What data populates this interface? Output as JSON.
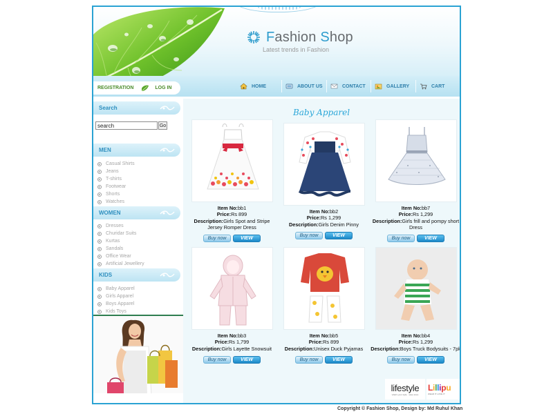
{
  "header": {
    "title_first_letter": "F",
    "title_part1": "ashion ",
    "title_second_letter": "S",
    "title_part2": "hop",
    "tagline": "Latest trends in Fashion"
  },
  "auth": {
    "register_label": "REGISTRATION",
    "login_label": "LOG IN"
  },
  "nav": {
    "items": [
      {
        "label": "HOME",
        "icon": "home-icon"
      },
      {
        "label": "ABOUT US",
        "icon": "about-icon"
      },
      {
        "label": "CONTACT",
        "icon": "mail-icon"
      },
      {
        "label": "GALLERY",
        "icon": "gallery-icon"
      },
      {
        "label": "CART",
        "icon": "cart-icon"
      }
    ]
  },
  "sidebar": {
    "search_heading": "Search",
    "search_value": "search",
    "go_label": "Go",
    "sections": [
      {
        "heading": "MEN",
        "items": [
          "Casual Shirts",
          "Jeans",
          "T-shirts",
          "Footwear",
          "Shorts",
          "Watches"
        ]
      },
      {
        "heading": "WOMEN",
        "items": [
          "Dresses",
          "Churidar Suits",
          "Kurtas",
          "Sandals",
          "Office Wear",
          "Artificial Jewellery"
        ]
      },
      {
        "heading": "KIDS",
        "items": [
          "Baby Apparel",
          "Girls Apparel",
          "Boys Apparel",
          "Kids Toys"
        ]
      }
    ]
  },
  "main": {
    "section_title": "Baby Apparel",
    "labels": {
      "item_no": "Item No:",
      "price": "Price:",
      "description": "Description:"
    },
    "buy_label": "Buy now",
    "view_label": "VIEW",
    "products": [
      {
        "item_no": "bb1",
        "price": "Rs 899",
        "description": "Girls Spot and Stripe Jersey Romper Dress"
      },
      {
        "item_no": "bb2",
        "price": "Rs 1,299",
        "description": "Girls Denim Pinny"
      },
      {
        "item_no": "bb7",
        "price": "Rs 1,299",
        "description": "Girls frill and pompy short Dress"
      },
      {
        "item_no": "bb3",
        "price": "Rs 1,799",
        "description": "Girls Layette Snowsuit"
      },
      {
        "item_no": "bb5",
        "price": "Rs 899",
        "description": "Unisex Duck Pyjamas"
      },
      {
        "item_no": "bb4",
        "price": "Rs 1,299",
        "description": "Boys Truck Bodysuits - 7pk"
      }
    ],
    "brands": {
      "lifestyle": "lifestyle",
      "lifestyle_sub": "what's your style · save store",
      "lilliput_chars": [
        "L",
        "i",
        "l",
        "l",
        "i",
        "p",
        "u"
      ],
      "lilliput_colors": [
        "#e53935",
        "#f9a825",
        "#43a047",
        "#1e88e5",
        "#8e24aa",
        "#e53935",
        "#f9a825"
      ],
      "lilliput_sub": "WEAR IT LOVE IT"
    }
  },
  "footer": {
    "text": "Copyright © Fashion Shop, Design by: ",
    "designer": "Md Ruhul Khan"
  }
}
